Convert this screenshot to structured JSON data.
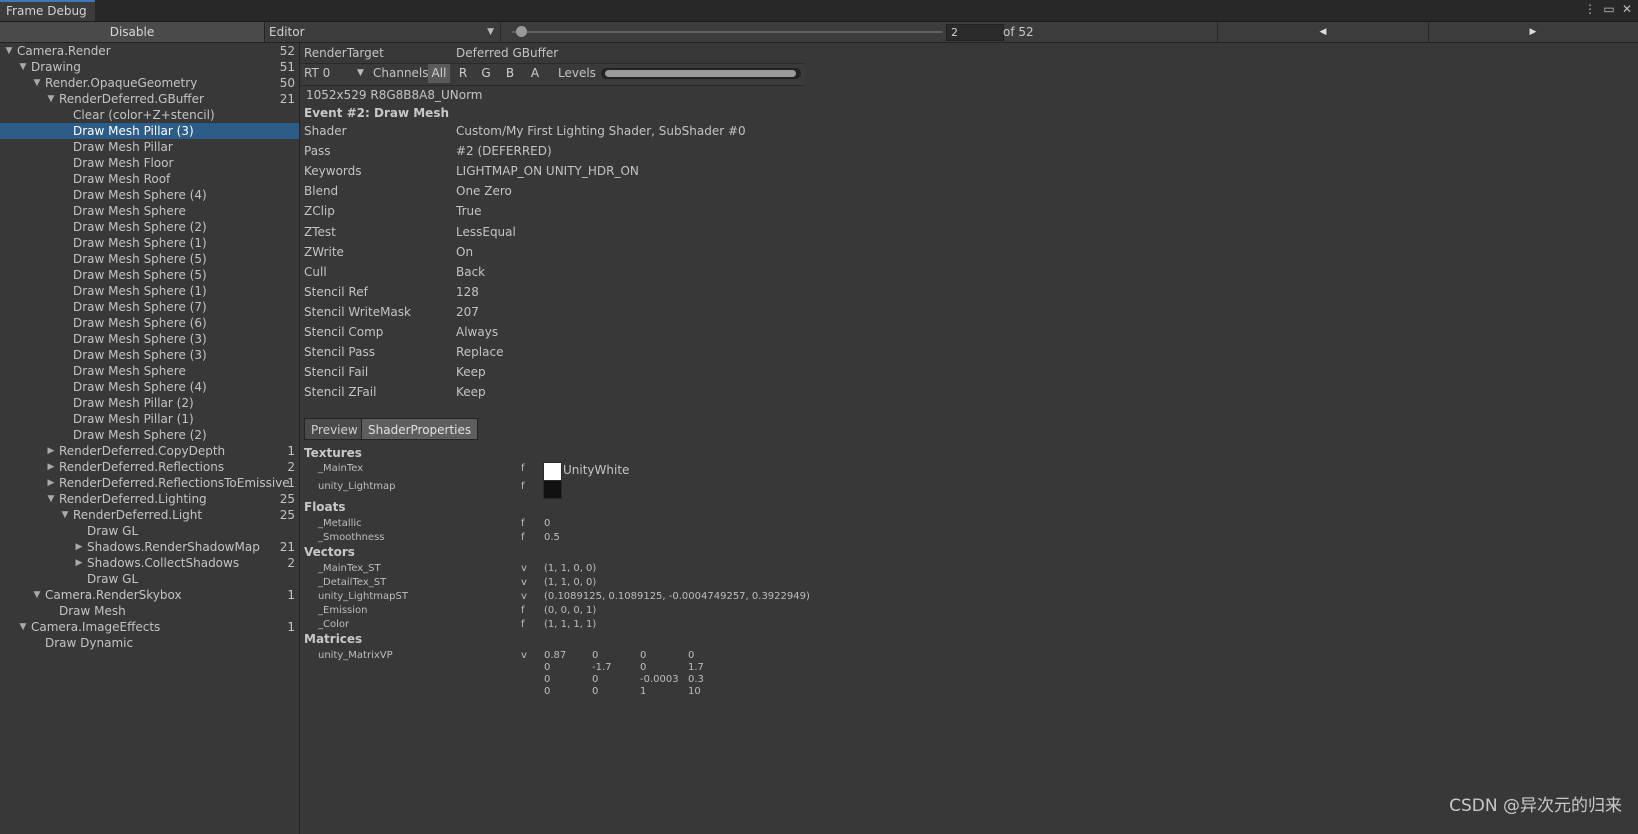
{
  "window": {
    "tab_title": "Frame Debug",
    "icons": [
      "more-vert-icon",
      "maximize-icon",
      "close-icon"
    ]
  },
  "toolbar": {
    "disable_label": "Disable",
    "target": "Editor",
    "event_index": "2",
    "event_total": "of 52",
    "slider_fraction": 0.02
  },
  "tree": [
    {
      "label": "Camera.Render",
      "count": "52",
      "depth": 0,
      "expanded": true
    },
    {
      "label": "Drawing",
      "count": "51",
      "depth": 1,
      "expanded": true
    },
    {
      "label": "Render.OpaqueGeometry",
      "count": "50",
      "depth": 2,
      "expanded": true
    },
    {
      "label": "RenderDeferred.GBuffer",
      "count": "21",
      "depth": 3,
      "expanded": true
    },
    {
      "label": "Clear (color+Z+stencil)",
      "count": "",
      "depth": 4
    },
    {
      "label": "Draw Mesh Pillar (3)",
      "count": "",
      "depth": 4,
      "selected": true
    },
    {
      "label": "Draw Mesh Pillar",
      "count": "",
      "depth": 4
    },
    {
      "label": "Draw Mesh Floor",
      "count": "",
      "depth": 4
    },
    {
      "label": "Draw Mesh Roof",
      "count": "",
      "depth": 4
    },
    {
      "label": "Draw Mesh Sphere (4)",
      "count": "",
      "depth": 4
    },
    {
      "label": "Draw Mesh Sphere",
      "count": "",
      "depth": 4
    },
    {
      "label": "Draw Mesh Sphere (2)",
      "count": "",
      "depth": 4
    },
    {
      "label": "Draw Mesh Sphere (1)",
      "count": "",
      "depth": 4
    },
    {
      "label": "Draw Mesh Sphere (5)",
      "count": "",
      "depth": 4
    },
    {
      "label": "Draw Mesh Sphere (5)",
      "count": "",
      "depth": 4
    },
    {
      "label": "Draw Mesh Sphere (1)",
      "count": "",
      "depth": 4
    },
    {
      "label": "Draw Mesh Sphere (7)",
      "count": "",
      "depth": 4
    },
    {
      "label": "Draw Mesh Sphere (6)",
      "count": "",
      "depth": 4
    },
    {
      "label": "Draw Mesh Sphere (3)",
      "count": "",
      "depth": 4
    },
    {
      "label": "Draw Mesh Sphere (3)",
      "count": "",
      "depth": 4
    },
    {
      "label": "Draw Mesh Sphere",
      "count": "",
      "depth": 4
    },
    {
      "label": "Draw Mesh Sphere (4)",
      "count": "",
      "depth": 4
    },
    {
      "label": "Draw Mesh Pillar (2)",
      "count": "",
      "depth": 4
    },
    {
      "label": "Draw Mesh Pillar (1)",
      "count": "",
      "depth": 4
    },
    {
      "label": "Draw Mesh Sphere (2)",
      "count": "",
      "depth": 4
    },
    {
      "label": "RenderDeferred.CopyDepth",
      "count": "1",
      "depth": 3,
      "expanded": false
    },
    {
      "label": "RenderDeferred.Reflections",
      "count": "2",
      "depth": 3,
      "expanded": false
    },
    {
      "label": "RenderDeferred.ReflectionsToEmissive",
      "count": "1",
      "depth": 3,
      "expanded": false
    },
    {
      "label": "RenderDeferred.Lighting",
      "count": "25",
      "depth": 3,
      "expanded": true
    },
    {
      "label": "RenderDeferred.Light",
      "count": "25",
      "depth": 4,
      "expanded": true
    },
    {
      "label": "Draw GL",
      "count": "",
      "depth": 5
    },
    {
      "label": "Shadows.RenderShadowMap",
      "count": "21",
      "depth": 5,
      "expanded": false
    },
    {
      "label": "Shadows.CollectShadows",
      "count": "2",
      "depth": 5,
      "expanded": false
    },
    {
      "label": "Draw GL",
      "count": "",
      "depth": 5
    },
    {
      "label": "Camera.RenderSkybox",
      "count": "1",
      "depth": 2,
      "expanded": true
    },
    {
      "label": "Draw Mesh",
      "count": "",
      "depth": 3
    },
    {
      "label": "Camera.ImageEffects",
      "count": "1",
      "depth": 1,
      "expanded": true
    },
    {
      "label": "Draw Dynamic",
      "count": "",
      "depth": 2
    }
  ],
  "details": {
    "render_target_label": "RenderTarget",
    "render_target_value": "Deferred GBuffer",
    "rt_select": "RT 0",
    "channels_label": "Channels",
    "channels": [
      "All",
      "R",
      "G",
      "B",
      "A"
    ],
    "levels_label": "Levels",
    "format": "1052x529 R8G8B8A8_UNorm",
    "event_title": "Event #2: Draw Mesh",
    "properties": [
      {
        "key": "Shader",
        "value": "Custom/My First Lighting Shader, SubShader #0"
      },
      {
        "key": "Pass",
        "value": "#2 (DEFERRED)"
      },
      {
        "key": "Keywords",
        "value": "LIGHTMAP_ON UNITY_HDR_ON"
      },
      {
        "key": "Blend",
        "value": "One Zero"
      },
      {
        "key": "ZClip",
        "value": "True"
      },
      {
        "key": "ZTest",
        "value": "LessEqual"
      },
      {
        "key": "ZWrite",
        "value": "On"
      },
      {
        "key": "Cull",
        "value": "Back"
      },
      {
        "key": "Stencil Ref",
        "value": "128"
      },
      {
        "key": "Stencil WriteMask",
        "value": "207"
      },
      {
        "key": "Stencil Comp",
        "value": "Always"
      },
      {
        "key": "Stencil Pass",
        "value": "Replace"
      },
      {
        "key": "Stencil Fail",
        "value": "Keep"
      },
      {
        "key": "Stencil ZFail",
        "value": "Keep"
      }
    ],
    "tabs": [
      "Preview",
      "ShaderProperties"
    ],
    "active_tab": "ShaderProperties"
  },
  "shader_properties": {
    "textures_header": "Textures",
    "textures": [
      {
        "name": "_MainTex",
        "stage": "f",
        "swatch": "#ffffff",
        "value": "UnityWhite"
      },
      {
        "name": "unity_Lightmap",
        "stage": "f",
        "swatch": "#111111",
        "value": ""
      }
    ],
    "floats_header": "Floats",
    "floats": [
      {
        "name": "_Metallic",
        "stage": "f",
        "value": "0"
      },
      {
        "name": "_Smoothness",
        "stage": "f",
        "value": "0.5"
      }
    ],
    "vectors_header": "Vectors",
    "vectors": [
      {
        "name": "_MainTex_ST",
        "stage": "v",
        "value": "(1, 1, 0, 0)"
      },
      {
        "name": "_DetailTex_ST",
        "stage": "v",
        "value": "(1, 1, 0, 0)"
      },
      {
        "name": "unity_LightmapST",
        "stage": "v",
        "value": "(0.1089125, 0.1089125, -0.0004749257, 0.3922949)"
      },
      {
        "name": "_Emission",
        "stage": "f",
        "value": "(0, 0, 0, 1)"
      },
      {
        "name": "_Color",
        "stage": "f",
        "value": "(1, 1, 1, 1)"
      }
    ],
    "matrices_header": "Matrices",
    "matrix_name": "unity_MatrixVP",
    "matrix_stage": "v",
    "matrix": [
      [
        "0.87",
        "0",
        "0",
        "0"
      ],
      [
        "0",
        "-1.7",
        "0",
        "1.7"
      ],
      [
        "0",
        "0",
        "-0.0003",
        "0.3"
      ],
      [
        "0",
        "0",
        "1",
        "10"
      ]
    ]
  },
  "watermark": "CSDN @异次元的归来",
  "colors": {
    "selection": "#2c5d87",
    "tab_accent": "#3a79bb",
    "background": "#383838"
  }
}
